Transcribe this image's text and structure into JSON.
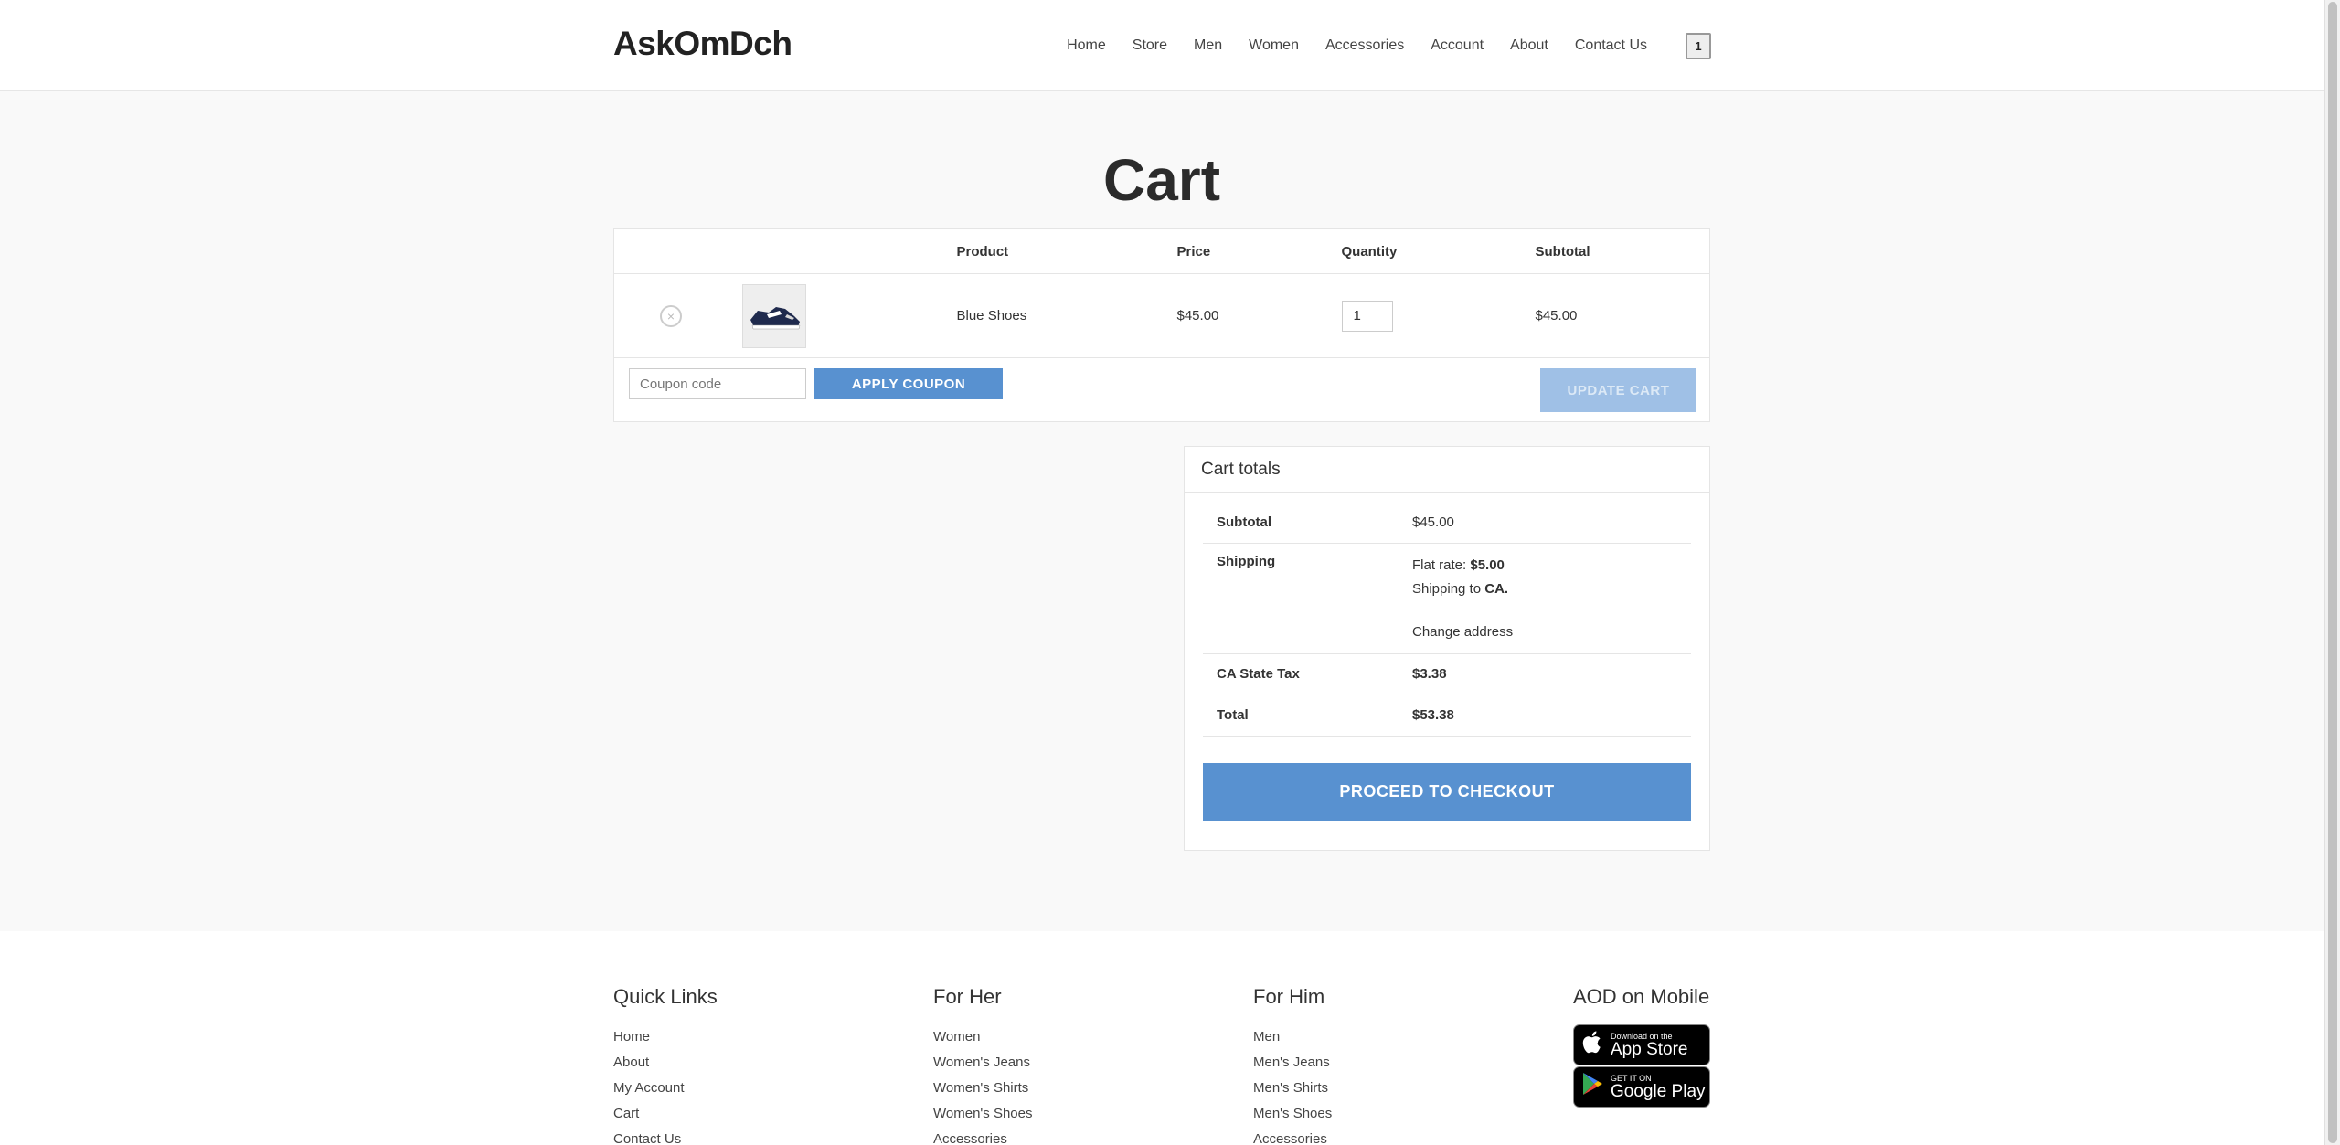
{
  "site": {
    "logo": "AskOmDch",
    "cart_count": "1"
  },
  "nav": [
    "Home",
    "Store",
    "Men",
    "Women",
    "Accessories",
    "Account",
    "About",
    "Contact Us"
  ],
  "page_title": "Cart",
  "cart_table": {
    "headers": {
      "product": "Product",
      "price": "Price",
      "quantity": "Quantity",
      "subtotal": "Subtotal"
    },
    "items": [
      {
        "remove_icon": "×",
        "thumbnail_icon": "shoe-icon",
        "product": "Blue Shoes",
        "price": "$45.00",
        "quantity": "1",
        "subtotal": "$45.00"
      }
    ],
    "coupon_placeholder": "Coupon code",
    "apply_coupon_label": "APPLY COUPON",
    "update_cart_label": "UPDATE CART"
  },
  "cart_totals": {
    "title": "Cart totals",
    "subtotal_label": "Subtotal",
    "subtotal_value": "$45.00",
    "shipping_label": "Shipping",
    "shipping_method": "Flat rate:",
    "shipping_cost": "$5.00",
    "shipping_to_prefix": "Shipping to",
    "shipping_to": "CA.",
    "change_address": "Change address",
    "tax_label": "CA State Tax",
    "tax_value": "$3.38",
    "total_label": "Total",
    "total_value": "$53.38",
    "checkout_label": "PROCEED TO CHECKOUT"
  },
  "footer": {
    "quick_links": {
      "title": "Quick Links",
      "items": [
        "Home",
        "About",
        "My Account",
        "Cart",
        "Contact Us"
      ]
    },
    "for_her": {
      "title": "For Her",
      "items": [
        "Women",
        "Women's Jeans",
        "Women's Shirts",
        "Women's Shoes",
        "Accessories"
      ]
    },
    "for_him": {
      "title": "For Him",
      "items": [
        "Men",
        "Men's Jeans",
        "Men's Shirts",
        "Men's Shoes",
        "Accessories"
      ]
    },
    "mobile": {
      "title": "AOD on Mobile",
      "app_store_small": "Download on the",
      "app_store_big": "App Store",
      "google_play_small": "GET IT ON",
      "google_play_big": "Google Play"
    }
  },
  "colors": {
    "accent": "#5891d0",
    "accent_disabled": "#9fc0e6",
    "page_bg": "#f9f9f9"
  }
}
